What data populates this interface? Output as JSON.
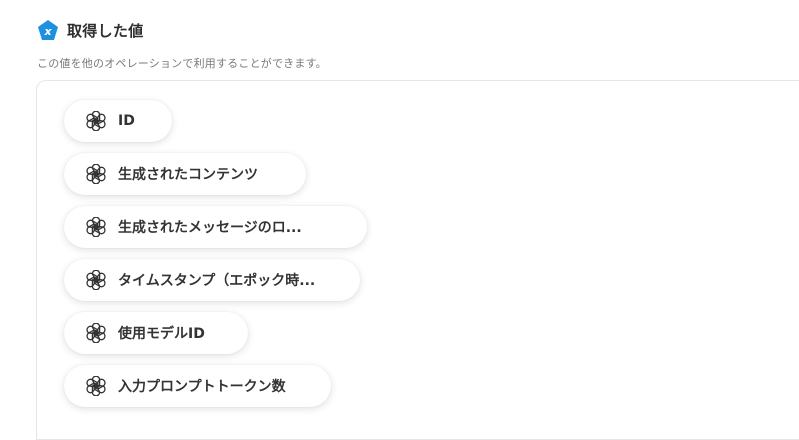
{
  "header": {
    "title": "取得した値",
    "icon": "variable-x-icon",
    "icon_color": "#1e90e0"
  },
  "subtitle": "この値を他のオペレーションで利用することができます。",
  "values": {
    "icon": "openai-icon",
    "items": [
      {
        "label": "ID"
      },
      {
        "label": "生成されたコンテンツ"
      },
      {
        "label": "生成されたメッセージのロ..."
      },
      {
        "label": "タイムスタンプ（エポック時..."
      },
      {
        "label": "使用モデルID"
      },
      {
        "label": "入力プロンプトトークン数"
      }
    ]
  }
}
